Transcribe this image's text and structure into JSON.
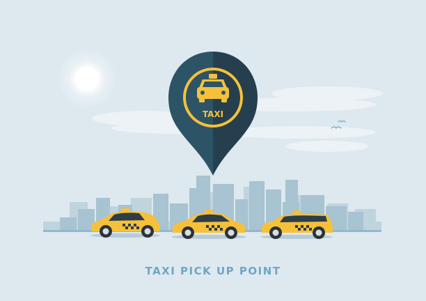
{
  "pin": {
    "icon": "taxi-icon",
    "label": "TAXI"
  },
  "caption": "TAXI PICK UP POINT",
  "colors": {
    "background": "#dde9ef",
    "pin_left": "#2d5366",
    "pin_right": "#253f4f",
    "taxi_yellow": "#f5c13b",
    "skyline": "#a8c3d1",
    "caption": "#6fa6c6"
  },
  "cars": [
    {
      "kind": "hatchback-taxi"
    },
    {
      "kind": "sedan-taxi"
    },
    {
      "kind": "station-wagon-taxi"
    }
  ]
}
